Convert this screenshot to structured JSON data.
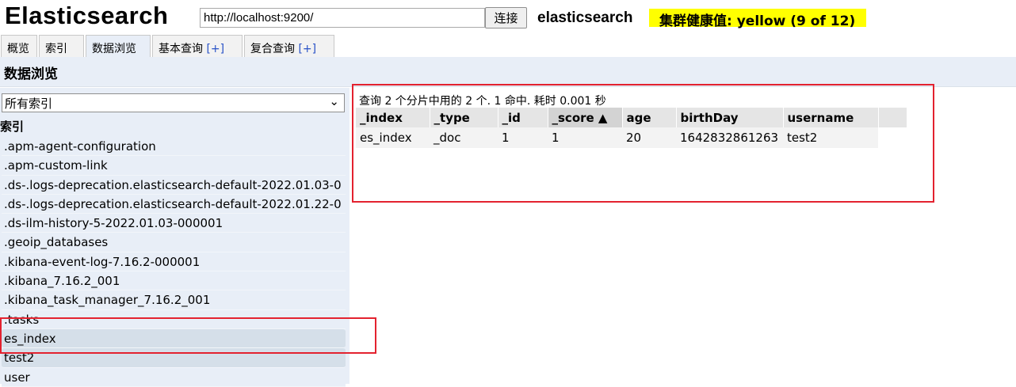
{
  "header": {
    "logo": "Elasticsearch",
    "url": "http://localhost:9200/",
    "connect_label": "连接",
    "cluster_name": "elasticsearch",
    "health": "集群健康值: yellow (9 of 12)"
  },
  "tabs": [
    {
      "label": "概览"
    },
    {
      "label": "索引"
    },
    {
      "label": "数据浏览"
    },
    {
      "label": "基本查询",
      "plus": "[+]"
    },
    {
      "label": "复合查询",
      "plus": "[+]"
    }
  ],
  "section_title": "数据浏览",
  "sidebar": {
    "selected_index": "所有索引",
    "label": "索引",
    "items": [
      ".apm-agent-configuration",
      ".apm-custom-link",
      ".ds-.logs-deprecation.elasticsearch-default-2022.01.03-0",
      ".ds-.logs-deprecation.elasticsearch-default-2022.01.22-0",
      ".ds-ilm-history-5-2022.01.03-000001",
      ".geoip_databases",
      ".kibana-event-log-7.16.2-000001",
      ".kibana_7.16.2_001",
      ".kibana_task_manager_7.16.2_001",
      ".tasks",
      "es_index",
      "test2",
      "user"
    ]
  },
  "results": {
    "summary": "查询 2 个分片中用的 2 个. 1 命中. 耗时 0.001 秒",
    "columns": [
      "_index",
      "_type",
      "_id",
      "_score ▲",
      "age",
      "birthDay",
      "username"
    ],
    "rows": [
      [
        "es_index",
        "_doc",
        "1",
        "1",
        "20",
        "1642832861263",
        "test2"
      ]
    ]
  },
  "colors": {
    "health": "#ffff00",
    "highlight": "#e3222f",
    "sidebar_bg": "#e8eef7"
  }
}
